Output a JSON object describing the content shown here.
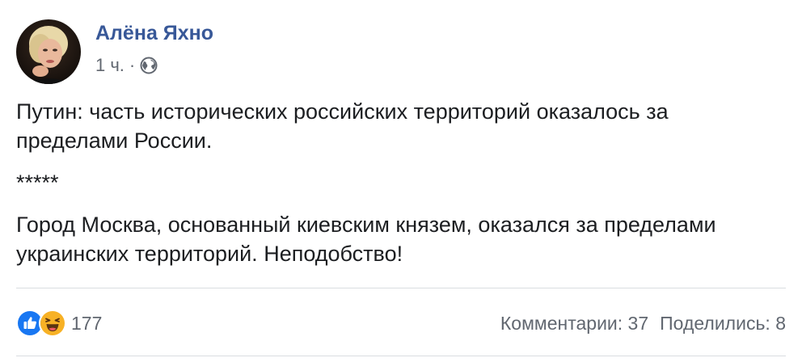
{
  "post": {
    "author": "Алёна Яхно",
    "time": "1 ч.",
    "separator": "·",
    "privacy_icon": "globe-icon",
    "paragraphs": [
      "Путин: часть исторических российских территорий оказалось за пределами России.",
      "*****",
      "Город Москва, основанный киевским князем, оказался за пределами украинских территорий. Неподобство!"
    ],
    "reactions": {
      "icons": [
        "like-icon",
        "haha-icon"
      ],
      "count": "177"
    },
    "comments_label": "Комментарии: 37",
    "shares_label": "Поделились: 8"
  },
  "colors": {
    "author_link": "#385898",
    "secondary_text": "#616770",
    "body_text": "#1c1e21",
    "divider": "#dadde1",
    "like_blue": "#1877f2",
    "haha_yellow": "#f7b125"
  }
}
